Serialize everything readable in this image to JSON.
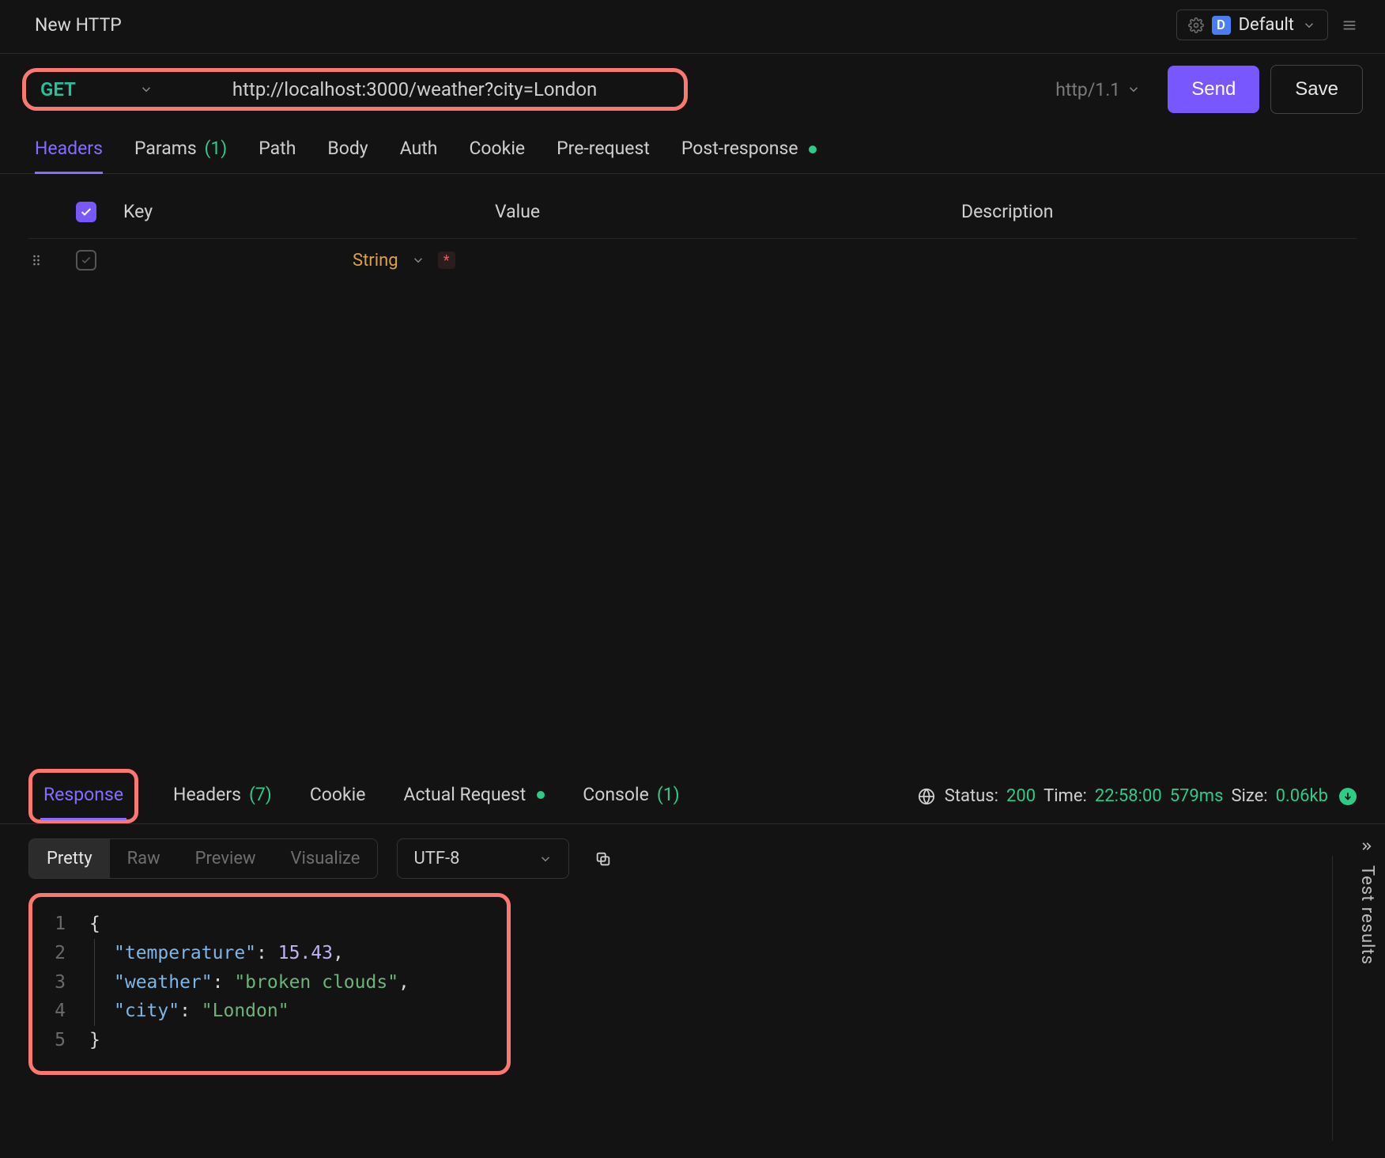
{
  "topbar": {
    "title": "New HTTP",
    "env_badge": "D",
    "env_name": "Default"
  },
  "request": {
    "method": "GET",
    "url": "http://localhost:3000/weather?city=London",
    "protocol": "http/1.1",
    "send_label": "Send",
    "save_label": "Save"
  },
  "req_tabs": {
    "headers": "Headers",
    "params": "Params",
    "params_count": "(1)",
    "path": "Path",
    "body": "Body",
    "auth": "Auth",
    "cookie": "Cookie",
    "prerequest": "Pre-request",
    "postresponse": "Post-response"
  },
  "headers_table": {
    "key_label": "Key",
    "value_label": "Value",
    "desc_label": "Description",
    "row_type": "String"
  },
  "resp_tabs": {
    "response": "Response",
    "headers": "Headers",
    "headers_count": "(7)",
    "cookie": "Cookie",
    "actual": "Actual Request",
    "console": "Console",
    "console_count": "(1)"
  },
  "status": {
    "status_label": "Status",
    "status_code": "200",
    "time_label": "Time",
    "time_clock": "22:58:00",
    "time_ms": "579ms",
    "size_label": "Size",
    "size_val": "0.06kb"
  },
  "format": {
    "pretty": "Pretty",
    "raw": "Raw",
    "preview": "Preview",
    "visualize": "Visualize",
    "encoding": "UTF-8"
  },
  "code_lines": [
    "1",
    "2",
    "3",
    "4",
    "5"
  ],
  "response_body": {
    "temperature_key": "\"temperature\"",
    "temperature_val": "15.43",
    "weather_key": "\"weather\"",
    "weather_val": "\"broken clouds\"",
    "city_key": "\"city\"",
    "city_val": "\"London\""
  },
  "side": {
    "test_results": "Test results"
  }
}
